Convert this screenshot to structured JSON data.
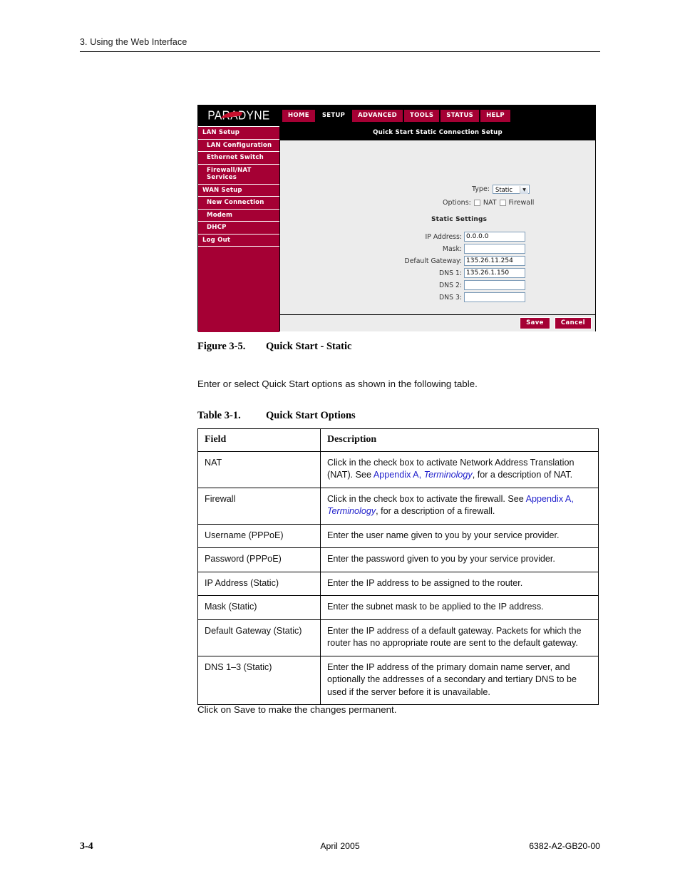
{
  "running_head": "3. Using the Web Interface",
  "router_ui": {
    "logo": "PARADYNE",
    "nav_tabs": [
      {
        "label": "HOME",
        "active": false
      },
      {
        "label": "SETUP",
        "active": true
      },
      {
        "label": "ADVANCED",
        "active": false
      },
      {
        "label": "TOOLS",
        "active": false
      },
      {
        "label": "STATUS",
        "active": false
      },
      {
        "label": "HELP",
        "active": false
      }
    ],
    "sidebar": [
      {
        "label": "LAN Setup",
        "sub": false
      },
      {
        "label": "LAN Configuration",
        "sub": true
      },
      {
        "label": "Ethernet Switch",
        "sub": true
      },
      {
        "label": "Firewall/NAT Services",
        "sub": true
      },
      {
        "label": "WAN Setup",
        "sub": false
      },
      {
        "label": "New Connection",
        "sub": true
      },
      {
        "label": "Modem",
        "sub": true
      },
      {
        "label": "DHCP",
        "sub": true
      },
      {
        "label": "Log Out",
        "sub": false
      }
    ],
    "panel_title": "Quick Start Static Connection Setup",
    "type_label": "Type:",
    "type_value": "Static",
    "options_label": "Options:",
    "option_nat": "NAT",
    "option_firewall": "Firewall",
    "section_label": "Static Settings",
    "fields": [
      {
        "label": "IP Address:",
        "value": "0.0.0.0"
      },
      {
        "label": "Mask:",
        "value": ""
      },
      {
        "label": "Default Gateway:",
        "value": "135.26.11.254"
      },
      {
        "label": "DNS 1:",
        "value": "135.26.1.150"
      },
      {
        "label": "DNS 2:",
        "value": ""
      },
      {
        "label": "DNS 3:",
        "value": ""
      }
    ],
    "save_label": "Save",
    "cancel_label": "Cancel",
    "accent_color": "#A50034",
    "panel_bg": "#ECECEC"
  },
  "figure_caption": {
    "number": "Figure 3-5.",
    "title": "Quick Start - Static"
  },
  "intro_paragraph": "Enter or select Quick Start options as shown in the following table.",
  "table_caption": {
    "number": "Table 3-1.",
    "title": "Quick Start Options"
  },
  "options_table": {
    "headers": [
      "Field",
      "Description"
    ],
    "rows": [
      {
        "field": "NAT",
        "desc_parts": [
          {
            "t": "Click in the check box to activate Network Address Translation (NAT). See ",
            "s": "plain"
          },
          {
            "t": "Appendix A,",
            "s": "link"
          },
          {
            "t": " ",
            "s": "plain"
          },
          {
            "t": "Terminology",
            "s": "link-italic"
          },
          {
            "t": ", for a description of NAT.",
            "s": "plain"
          }
        ]
      },
      {
        "field": "Firewall",
        "desc_parts": [
          {
            "t": "Click in the check box to activate the firewall. See ",
            "s": "plain"
          },
          {
            "t": "Appendix A,",
            "s": "link"
          },
          {
            "t": " ",
            "s": "plain"
          },
          {
            "t": "Terminology",
            "s": "link-italic"
          },
          {
            "t": ", for a description of a firewall.",
            "s": "plain"
          }
        ]
      },
      {
        "field": "Username (PPPoE)",
        "desc_parts": [
          {
            "t": "Enter the user name given to you by your service provider.",
            "s": "plain"
          }
        ]
      },
      {
        "field": "Password (PPPoE)",
        "desc_parts": [
          {
            "t": "Enter the password given to you by your service provider.",
            "s": "plain"
          }
        ]
      },
      {
        "field": "IP Address (Static)",
        "desc_parts": [
          {
            "t": "Enter the IP address to be assigned to the router.",
            "s": "plain"
          }
        ]
      },
      {
        "field": "Mask (Static)",
        "desc_parts": [
          {
            "t": "Enter the subnet mask to be applied to the IP address.",
            "s": "plain"
          }
        ]
      },
      {
        "field": "Default Gateway (Static)",
        "desc_parts": [
          {
            "t": "Enter the IP address of a default gateway. Packets for which the router has no appropriate route are sent to the default gateway.",
            "s": "plain"
          }
        ]
      },
      {
        "field": "DNS 1–3 (Static)",
        "desc_parts": [
          {
            "t": "Enter the IP address of the primary domain name server, and optionally the addresses of a secondary and tertiary DNS to be used if the server before it is unavailable.",
            "s": "plain"
          }
        ]
      }
    ]
  },
  "closing_paragraph": "Click on Save to make the changes permanent.",
  "footer": {
    "page": "3-4",
    "date": "April 2005",
    "doc_id": "6382-A2-GB20-00"
  }
}
